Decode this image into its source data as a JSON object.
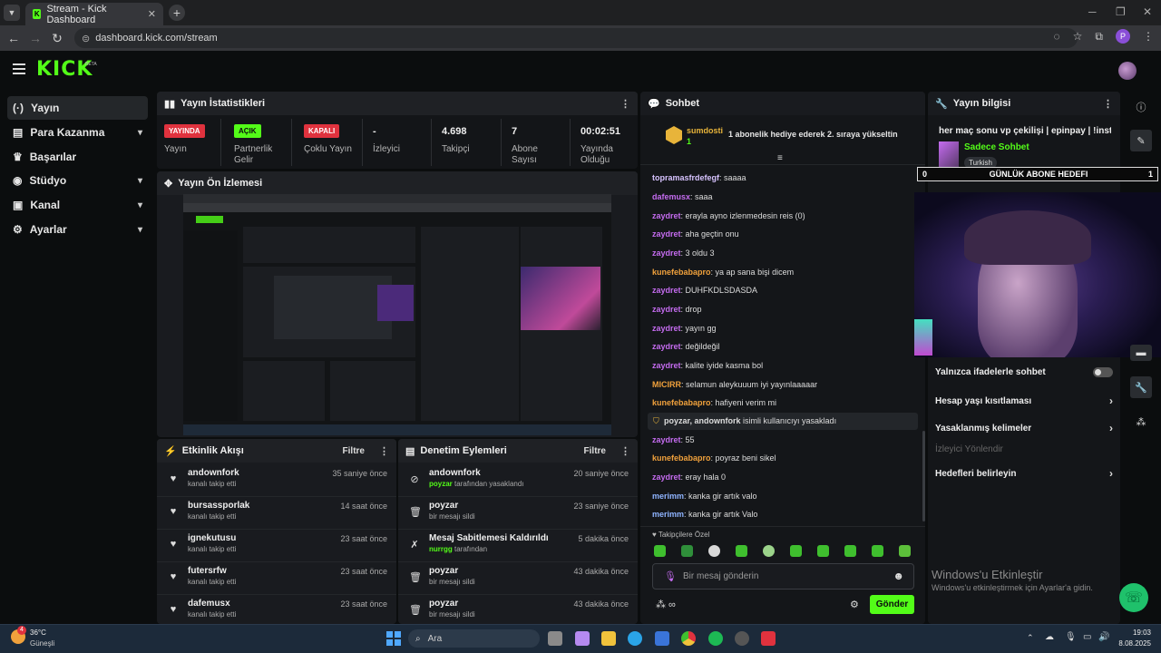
{
  "browser": {
    "tab_title": "Stream - Kick Dashboard",
    "url": "dashboard.kick.com/stream",
    "profile_initial": "P"
  },
  "header": {
    "logo": "KICK",
    "beta": "BETA"
  },
  "sidebar": {
    "items": [
      {
        "label": "Yayın",
        "icon": "broadcast-icon"
      },
      {
        "label": "Para Kazanma",
        "icon": "money-icon"
      },
      {
        "label": "Başarılar",
        "icon": "trophy-icon"
      },
      {
        "label": "Stüdyo",
        "icon": "studio-icon"
      },
      {
        "label": "Kanal",
        "icon": "channel-icon"
      },
      {
        "label": "Ayarlar",
        "icon": "gear-icon"
      }
    ]
  },
  "stats": {
    "title": "Yayın İstatistikleri",
    "items": [
      {
        "value": "YAYINDA",
        "label": "Yayın",
        "color": "#e0323e"
      },
      {
        "value": "AÇIK",
        "label": "Partnerlik Gelir",
        "color": "#53fc18"
      },
      {
        "value": "KAPALI",
        "label": "Çoklu Yayın",
        "color": "#e0323e"
      },
      {
        "value": "-",
        "label": "İzleyici"
      },
      {
        "value": "4.698",
        "label": "Takipçi"
      },
      {
        "value": "7",
        "label": "Abone Sayısı"
      },
      {
        "value": "00:02:51",
        "label": "Yayında Olduğu"
      }
    ]
  },
  "preview": {
    "title": "Yayın Ön İzlemesi"
  },
  "activity": {
    "title": "Etkinlik Akışı",
    "filter": "Filtre",
    "rows": [
      {
        "name": "andownfork",
        "sub": "kanalı takip etti",
        "time": "35 saniye önce"
      },
      {
        "name": "bursassporlak",
        "sub": "kanalı takip etti",
        "time": "14 saat önce"
      },
      {
        "name": "ignekutusu",
        "sub": "kanalı takip etti",
        "time": "23 saat önce"
      },
      {
        "name": "futersrfw",
        "sub": "kanalı takip etti",
        "time": "23 saat önce"
      },
      {
        "name": "dafemusx",
        "sub": "kanalı takip etti",
        "time": "23 saat önce"
      }
    ]
  },
  "moderation": {
    "title": "Denetim Eylemleri",
    "filter": "Filtre",
    "rows": [
      {
        "name": "andownfork",
        "actor": "poyzar",
        "sub": "tarafından yasaklandı",
        "time": "20 saniye önce",
        "icon": "ban-icon"
      },
      {
        "name": "poyzar",
        "actor": "",
        "sub": "bir mesajı sildi",
        "time": "23 saniye önce",
        "icon": "trash-icon"
      },
      {
        "name": "Mesaj Sabitlemesi Kaldırıldı",
        "actor": "nurrgg",
        "sub": "tarafından",
        "time": "5 dakika önce",
        "icon": "unpin-icon"
      },
      {
        "name": "poyzar",
        "actor": "",
        "sub": "bir mesajı sildi",
        "time": "43 dakika önce",
        "icon": "trash-icon"
      },
      {
        "name": "poyzar",
        "actor": "",
        "sub": "bir mesajı sildi",
        "time": "43 dakika önce",
        "icon": "trash-icon"
      }
    ]
  },
  "chat": {
    "title": "Sohbet",
    "pinned_user": "sumdosti",
    "pinned_count": "1",
    "pinned_text": "1 abonelik hediye ederek 2. sıraya yükseltin",
    "messages": [
      {
        "user": "topramasfrdefegf",
        "text": "saaaa",
        "color": "#d7c3ff"
      },
      {
        "user": "dafemusx",
        "text": "saaa",
        "color": "#c56cf0"
      },
      {
        "user": "zaydret",
        "text": "erayla ayno izlenmedesin reis (0)",
        "color": "#c56cf0"
      },
      {
        "user": "zaydret",
        "text": "aha geçtin onu",
        "color": "#c56cf0"
      },
      {
        "user": "zaydret",
        "text": "3 oldu 3",
        "color": "#c56cf0"
      },
      {
        "user": "kunefebabapro",
        "text": "ya ap sana bişi dicem",
        "color": "#f0a13c"
      },
      {
        "user": "zaydret",
        "text": "DUHFKDLSDASDA",
        "color": "#c56cf0"
      },
      {
        "user": "zaydret",
        "text": "drop",
        "color": "#c56cf0"
      },
      {
        "user": "zaydret",
        "text": "yayın gg",
        "color": "#c56cf0"
      },
      {
        "user": "zaydret",
        "text": "değildeğil",
        "color": "#c56cf0"
      },
      {
        "user": "zaydret",
        "text": "kalite iyide kasma bol",
        "color": "#c56cf0"
      },
      {
        "user": "MICIRR",
        "text": "selamun aleykuuum iyi yayınlaaaaar",
        "color": "#f0a13c"
      },
      {
        "user": "kunefebabapro",
        "text": "hafiyeni verim mi",
        "color": "#f0a13c"
      },
      {
        "user": "zaydret",
        "text": "55",
        "color": "#c56cf0"
      },
      {
        "user": "kunefebabapro",
        "text": "poyraz beni sikel",
        "color": "#f0a13c"
      },
      {
        "user": "zaydret",
        "text": "eray hala 0",
        "color": "#c56cf0"
      },
      {
        "user": "merimm",
        "text": "kanka gir artık valo",
        "color": "#8fb4ff"
      },
      {
        "user": "merimm",
        "text": "kanka gir artık Valo",
        "color": "#8fb4ff"
      }
    ],
    "ban_notice": {
      "users": "poyzar, andownfork",
      "text": "isimli kullanıcıyı yasakladı"
    },
    "followers_label": "Takipçilere Özel",
    "input_placeholder": "Bir mesaj gönderin",
    "send_label": "Gönder"
  },
  "info": {
    "title": "Yayın bilgisi",
    "stream_title": "her maç sonu vp çekilişi | ",
    "stream_title_tail": "epinpay | !insta",
    "category": "Sadece Sohbet",
    "language": "Turkish",
    "goal_left": "0",
    "goal_label": "GÜNLÜK ABONE HEDEFI",
    "goal_right": "1",
    "rows": [
      {
        "label": "Yalnızca ifadelerle sohbet",
        "type": "toggle"
      },
      {
        "label": "Hesap yaşı kısıtlaması",
        "type": "chevron"
      },
      {
        "label": "Yasaklanmış kelimeler",
        "type": "chevron"
      },
      {
        "label": "İzleyici Yönlendir",
        "type": "disabled"
      },
      {
        "label": "Hedefleri belirleyin",
        "type": "chevron"
      }
    ]
  },
  "watermark": {
    "title": "Windows'u Etkinleştir",
    "sub": "Windows'u etkinleştirmek için Ayarlar'a gidin."
  },
  "taskbar": {
    "weather_temp": "36°C",
    "weather_desc": "Güneşli",
    "weather_badge": "4",
    "search": "Ara",
    "time": "19:03",
    "date": "8.08.2025"
  }
}
